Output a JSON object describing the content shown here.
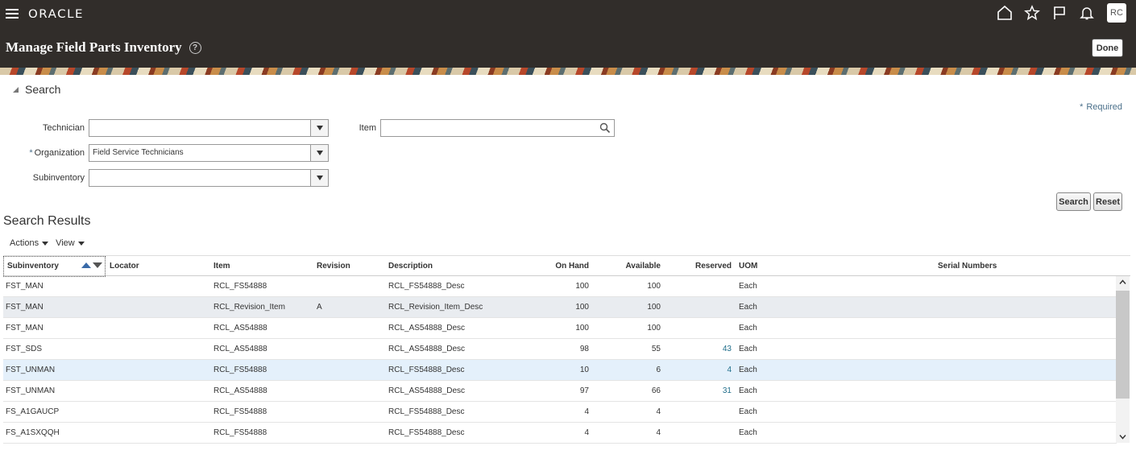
{
  "header": {
    "logo": "ORACLE",
    "page_title": "Manage Field Parts Inventory",
    "avatar_initials": "RC",
    "done_label": "Done",
    "help_glyph": "?"
  },
  "search": {
    "section_label": "Search",
    "required_label": "Required",
    "required_marker": "*",
    "technician_label": "Technician",
    "technician_value": "",
    "organization_label": "Organization",
    "organization_value": "Field Service Technicians",
    "subinventory_label": "Subinventory",
    "subinventory_value": "",
    "item_label": "Item",
    "item_value": "",
    "search_button": "Search",
    "reset_button": "Reset"
  },
  "results": {
    "title": "Search Results",
    "actions_label": "Actions",
    "view_label": "View",
    "columns": {
      "subinventory": "Subinventory",
      "locator": "Locator",
      "item": "Item",
      "revision": "Revision",
      "description": "Description",
      "on_hand": "On Hand",
      "available": "Available",
      "reserved": "Reserved",
      "uom": "UOM",
      "serial_numbers": "Serial Numbers"
    },
    "rows": [
      {
        "subinventory": "FST_MAN",
        "locator": "",
        "item": "RCL_FS54888",
        "revision": "",
        "description": "RCL_FS54888_Desc",
        "on_hand": "100",
        "available": "100",
        "reserved": "",
        "uom": "Each",
        "serial": ""
      },
      {
        "subinventory": "FST_MAN",
        "locator": "",
        "item": "RCL_Revision_Item",
        "revision": "A",
        "description": "RCL_Revision_Item_Desc",
        "on_hand": "100",
        "available": "100",
        "reserved": "",
        "uom": "Each",
        "serial": ""
      },
      {
        "subinventory": "FST_MAN",
        "locator": "",
        "item": "RCL_AS54888",
        "revision": "",
        "description": "RCL_AS54888_Desc",
        "on_hand": "100",
        "available": "100",
        "reserved": "",
        "uom": "Each",
        "serial": ""
      },
      {
        "subinventory": "FST_SDS",
        "locator": "",
        "item": "RCL_AS54888",
        "revision": "",
        "description": "RCL_AS54888_Desc",
        "on_hand": "98",
        "available": "55",
        "reserved": "43",
        "uom": "Each",
        "serial": ""
      },
      {
        "subinventory": "FST_UNMAN",
        "locator": "",
        "item": "RCL_FS54888",
        "revision": "",
        "description": "RCL_FS54888_Desc",
        "on_hand": "10",
        "available": "6",
        "reserved": "4",
        "uom": "Each",
        "serial": ""
      },
      {
        "subinventory": "FST_UNMAN",
        "locator": "",
        "item": "RCL_AS54888",
        "revision": "",
        "description": "RCL_AS54888_Desc",
        "on_hand": "97",
        "available": "66",
        "reserved": "31",
        "uom": "Each",
        "serial": ""
      },
      {
        "subinventory": "FS_A1GAUCP",
        "locator": "",
        "item": "RCL_FS54888",
        "revision": "",
        "description": "RCL_FS54888_Desc",
        "on_hand": "4",
        "available": "4",
        "reserved": "",
        "uom": "Each",
        "serial": ""
      },
      {
        "subinventory": "FS_A1SXQQH",
        "locator": "",
        "item": "RCL_FS54888",
        "revision": "",
        "description": "RCL_FS54888_Desc",
        "on_hand": "4",
        "available": "4",
        "reserved": "",
        "uom": "Each",
        "serial": ""
      }
    ]
  },
  "colors": {
    "header_bg": "#312d2a",
    "link": "#1f6d8a",
    "selected_row": "#e4f0fb",
    "alt_row": "#e9ecf0"
  }
}
